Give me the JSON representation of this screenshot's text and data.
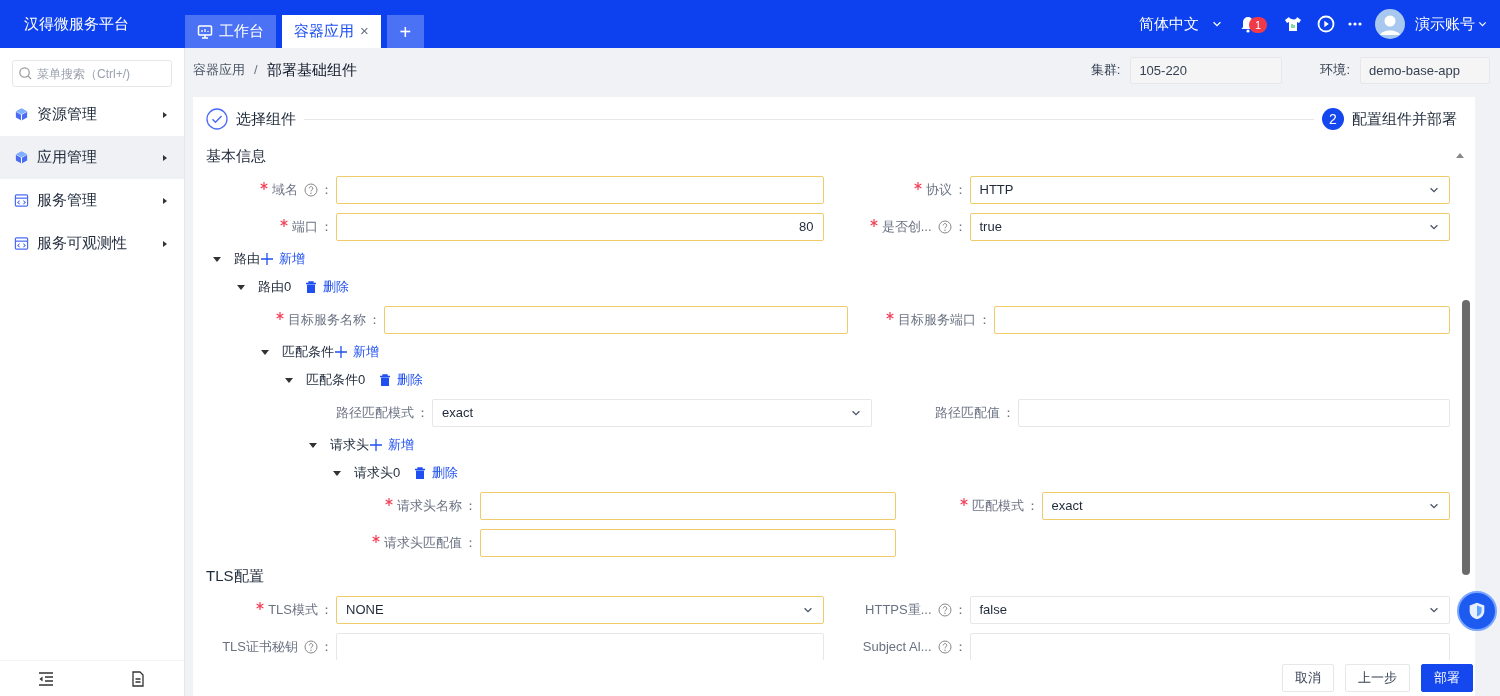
{
  "app_title": "汉得微服务平台",
  "tabs": [
    {
      "label": "工作台",
      "selected": false,
      "kind": "home"
    },
    {
      "label": "容器应用",
      "selected": true,
      "kind": "page",
      "close": "×"
    }
  ],
  "add_tab": "+",
  "header": {
    "language": "简体中文",
    "notification_count": "1",
    "user": "演示账号"
  },
  "sidebar": {
    "search_placeholder": "菜单搜索（Ctrl+/)",
    "items": [
      {
        "label": "资源管理",
        "selected": false,
        "kind": "cube"
      },
      {
        "label": "应用管理",
        "selected": true,
        "kind": "cube"
      },
      {
        "label": "服务管理",
        "selected": false,
        "kind": "panel"
      },
      {
        "label": "服务可观测性",
        "selected": false,
        "kind": "panel"
      }
    ]
  },
  "breadcrumb": {
    "items": [
      "容器应用",
      "部署基础组件"
    ],
    "separator": "/"
  },
  "context": [
    {
      "label": "集群:",
      "value": "105-220",
      "disabled": true
    },
    {
      "label": "环境:",
      "value": "demo-base-app",
      "disabled": true
    }
  ],
  "steps": [
    {
      "label": "选择组件",
      "completed": true
    },
    {
      "number": "2",
      "label": "配置组件并部署",
      "completed": false
    }
  ],
  "form": {
    "sections": [
      {
        "title": "基本信息",
        "expanded": true,
        "items": [
          {
            "kind": "fields",
            "fields": [
              {
                "label": "域名",
                "required": true,
                "help": true,
                "colon": "：",
                "kind": "text"
              },
              {
                "label": "协议",
                "required": true,
                "help": false,
                "colon": "：",
                "kind": "select",
                "value": "HTTP"
              }
            ]
          },
          {
            "kind": "fields",
            "fields": [
              {
                "label": "端口",
                "required": true,
                "help": false,
                "colon": "：",
                "kind": "number",
                "value": "80"
              },
              {
                "label": "是否创...",
                "required": true,
                "help": true,
                "colon": "：",
                "kind": "select",
                "value": "true"
              }
            ]
          },
          {
            "kind": "group",
            "label": "路由",
            "expanded": true,
            "action": {
              "kind": "add",
              "label": "新增"
            },
            "children": [
              {
                "kind": "group",
                "label": "路由0",
                "expanded": true,
                "action": {
                  "kind": "delete",
                  "label": "删除"
                },
                "children": [
                  {
                    "kind": "fields",
                    "fields": [
                      {
                        "label": "目标服务名称",
                        "required": true,
                        "help": false,
                        "colon": "：",
                        "kind": "text"
                      },
                      {
                        "label": "目标服务端口",
                        "required": true,
                        "help": false,
                        "colon": "：",
                        "kind": "text"
                      }
                    ]
                  },
                  {
                    "kind": "group",
                    "label": "匹配条件",
                    "expanded": true,
                    "action": {
                      "kind": "add",
                      "label": "新增"
                    },
                    "children": [
                      {
                        "kind": "group",
                        "label": "匹配条件0",
                        "expanded": true,
                        "action": {
                          "kind": "delete",
                          "label": "删除"
                        },
                        "children": [
                          {
                            "kind": "fields",
                            "fields": [
                              {
                                "label": "路径匹配模式",
                                "required": false,
                                "help": false,
                                "colon": "：",
                                "kind": "select",
                                "value": "exact"
                              },
                              {
                                "label": "路径匹配值",
                                "required": false,
                                "help": false,
                                "colon": "：",
                                "kind": "text"
                              }
                            ]
                          },
                          {
                            "kind": "group",
                            "label": "请求头",
                            "expanded": true,
                            "action": {
                              "kind": "add",
                              "label": "新增"
                            },
                            "children": [
                              {
                                "kind": "group",
                                "label": "请求头0",
                                "expanded": true,
                                "action": {
                                  "kind": "delete",
                                  "label": "删除"
                                },
                                "children": [
                                  {
                                    "kind": "fields",
                                    "fields": [
                                      {
                                        "label": "请求头名称",
                                        "required": true,
                                        "help": false,
                                        "colon": "：",
                                        "kind": "text"
                                      },
                                      {
                                        "label": "匹配模式",
                                        "required": true,
                                        "help": false,
                                        "colon": "：",
                                        "kind": "select",
                                        "value": "exact"
                                      }
                                    ]
                                  },
                                  {
                                    "kind": "fields",
                                    "fields": [
                                      {
                                        "label": "请求头匹配值",
                                        "required": true,
                                        "help": false,
                                        "colon": "：",
                                        "kind": "text"
                                      }
                                    ]
                                  }
                                ]
                              }
                            ]
                          }
                        ]
                      }
                    ]
                  }
                ]
              }
            ]
          }
        ]
      },
      {
        "title": "TLS配置",
        "items": [
          {
            "kind": "fields",
            "fields": [
              {
                "label": "TLS模式",
                "required": true,
                "help": false,
                "colon": "：",
                "kind": "select",
                "value": "NONE"
              },
              {
                "label": "HTTPS重...",
                "required": false,
                "help": true,
                "colon": "：",
                "kind": "select",
                "value": "false"
              }
            ]
          },
          {
            "kind": "fields",
            "fields": [
              {
                "label": "TLS证书秘钥",
                "required": false,
                "help": true,
                "colon": "：",
                "kind": "text"
              },
              {
                "label": "Subject Al...",
                "required": false,
                "help": true,
                "colon": "：",
                "kind": "text"
              }
            ]
          }
        ]
      }
    ]
  },
  "footer_buttons": [
    {
      "label": "取消",
      "kind": "default"
    },
    {
      "label": "上一步",
      "kind": "default"
    },
    {
      "label": "部署",
      "kind": "primary"
    }
  ]
}
